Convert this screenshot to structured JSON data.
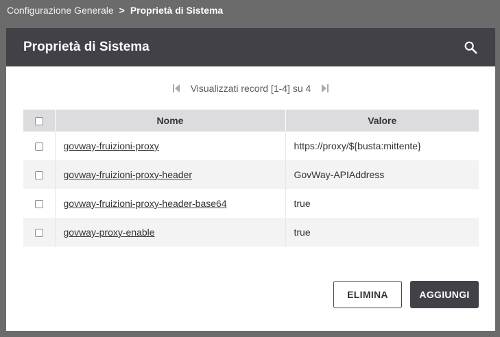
{
  "breadcrumb": {
    "parent": "Configurazione Generale",
    "separator": ">",
    "current": "Proprietà di Sistema"
  },
  "panel": {
    "title": "Proprietà di Sistema",
    "search_icon": "search-icon"
  },
  "pager": {
    "text": "Visualizzati record [1-4] su 4",
    "first_icon": "first-page-icon",
    "last_icon": "last-page-icon"
  },
  "table": {
    "columns": [
      "Nome",
      "Valore"
    ],
    "rows": [
      {
        "name": "govway-fruizioni-proxy",
        "value": "https://proxy/${busta:mittente}"
      },
      {
        "name": "govway-fruizioni-proxy-header",
        "value": "GovWay-APIAddress"
      },
      {
        "name": "govway-fruizioni-proxy-header-base64",
        "value": "true"
      },
      {
        "name": "govway-proxy-enable",
        "value": "true"
      }
    ]
  },
  "actions": {
    "delete_label": "ELIMINA",
    "add_label": "AGGIUNGI"
  },
  "colors": {
    "header_bg": "#414147",
    "backdrop": "#6b6b6b",
    "table_header_bg": "#dcdcdf",
    "row_alt_bg": "#f3f3f3"
  }
}
